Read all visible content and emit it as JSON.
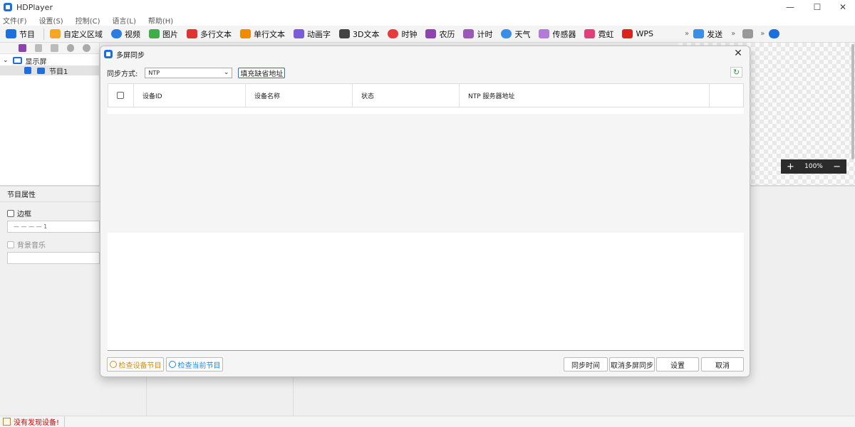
{
  "window": {
    "title": "HDPlayer",
    "minimize": "—",
    "maximize": "☐",
    "close": "✕"
  },
  "menu": [
    "文件(F)",
    "设置(S)",
    "控制(C)",
    "语言(L)",
    "帮助(H)"
  ],
  "toolbar": [
    {
      "label": "节目",
      "icon": "program-icon",
      "color": "#1e6fd9"
    },
    {
      "label": "自定义区域",
      "icon": "custom-area-icon",
      "color": "#f5a623"
    },
    {
      "label": "视频",
      "icon": "video-icon",
      "color": "#2d7de0"
    },
    {
      "label": "图片",
      "icon": "image-icon",
      "color": "#3fae49"
    },
    {
      "label": "多行文本",
      "icon": "multiline-text-icon",
      "color": "#d33"
    },
    {
      "label": "单行文本",
      "icon": "single-line-text-icon",
      "color": "#f08a00"
    },
    {
      "label": "动画字",
      "icon": "animated-text-icon",
      "color": "#7b5cd6"
    },
    {
      "label": "3D文本",
      "icon": "3d-text-icon",
      "color": "#444"
    },
    {
      "label": "时钟",
      "icon": "clock-icon",
      "color": "#e23c3c"
    },
    {
      "label": "农历",
      "icon": "lunar-calendar-icon",
      "color": "#8e44ad"
    },
    {
      "label": "计时",
      "icon": "timer-icon",
      "color": "#9b59b6"
    },
    {
      "label": "天气",
      "icon": "weather-icon",
      "color": "#3a8ee6"
    },
    {
      "label": "传感器",
      "icon": "sensor-icon",
      "color": "#b07cd6"
    },
    {
      "label": "霓虹",
      "icon": "neon-icon",
      "color": "#e0407a"
    },
    {
      "label": "WPS",
      "icon": "wps-icon",
      "color": "#d9231f"
    }
  ],
  "toolbar_more": "»",
  "send_label": "发送",
  "tree": {
    "screen": "显示屏",
    "program": "节目1"
  },
  "props": {
    "title": "节目属性",
    "border": "边框",
    "border_value": "— — — —   1",
    "bgmusic": "背景音乐"
  },
  "zoom": {
    "minus": "−",
    "plus": "+",
    "value": "100%"
  },
  "status": "没有发现设备!",
  "dialog": {
    "title": "多屏同步",
    "sync_mode_label": "同步方式:",
    "sync_mode_value": "NTP",
    "fill_default": "填充缺省地址",
    "columns": [
      "设备ID",
      "设备名称",
      "状态",
      "NTP 服务器地址"
    ],
    "buttons": {
      "check_device": "检查设备节目",
      "check_current": "检查当前节目",
      "sync_time": "同步时间",
      "cancel_multi": "取消多屏同步",
      "settings": "设置",
      "cancel": "取消"
    }
  }
}
